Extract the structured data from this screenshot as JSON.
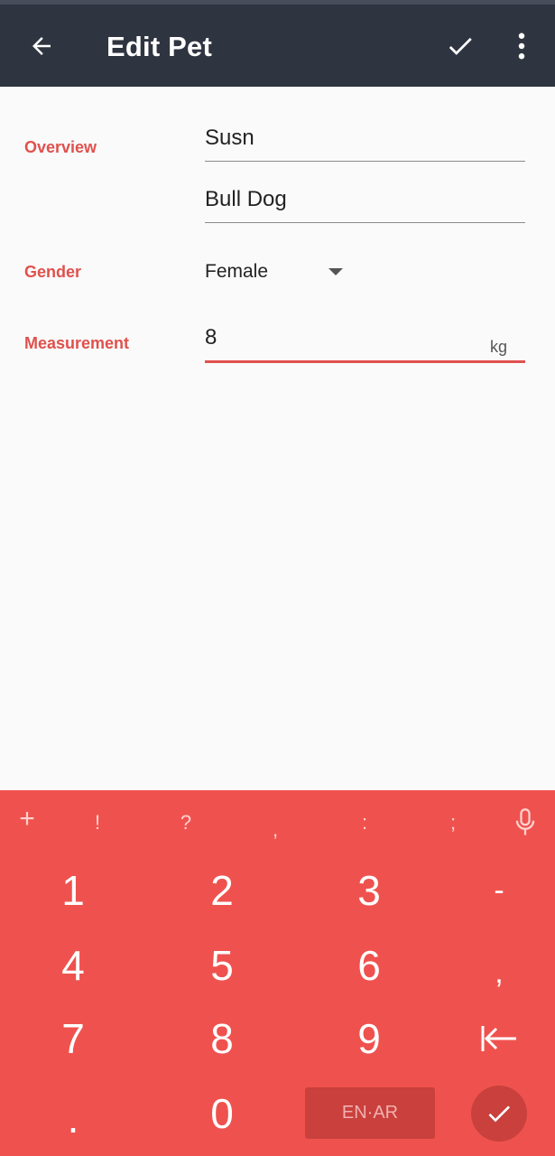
{
  "app_bar": {
    "title": "Edit Pet",
    "back_icon": "arrow-back-icon",
    "save_icon": "check-icon",
    "more_icon": "more-vert-icon"
  },
  "form": {
    "overview_label": "Overview",
    "name_value": "Susn",
    "breed_value": "Bull Dog",
    "gender_label": "Gender",
    "gender_value": "Female",
    "measurement_label": "Measurement",
    "measurement_value": "8",
    "measurement_unit": "kg"
  },
  "keyboard": {
    "symbols": [
      "+",
      "!",
      "?",
      ",",
      ":",
      ";"
    ],
    "mic_icon": "mic-icon",
    "rows": [
      [
        "1",
        "2",
        "3",
        "-"
      ],
      [
        "4",
        "5",
        "6",
        ","
      ],
      [
        "7",
        "8",
        "9"
      ],
      [
        ".",
        "0"
      ]
    ],
    "tab_icon": "tab-left-icon",
    "language_label": "EN·AR",
    "done_icon": "check-icon"
  },
  "colors": {
    "app_bar": "#2f3540",
    "accent": "#e0514d",
    "keyboard": "#ef524e"
  }
}
